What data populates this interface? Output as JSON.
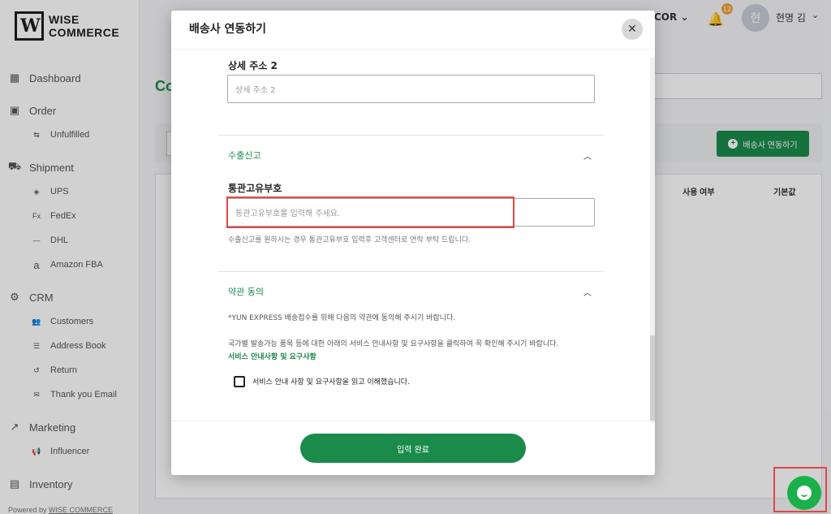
{
  "app": {
    "logo_letter": "W",
    "logo_line1": "WISE",
    "logo_line2": "COMMERCE",
    "powered_prefix": "Powered by",
    "powered_brand": "WISE COMMERCE"
  },
  "sidebar": {
    "dashboard": "Dashboard",
    "order": "Order",
    "unfulfilled": "Unfulfilled",
    "shipment": "Shipment",
    "ups": "UPS",
    "fedex": "FedEx",
    "dhl": "DHL",
    "amazon_fba": "Amazon FBA",
    "crm": "CRM",
    "customers": "Customers",
    "address_book": "Address Book",
    "return": "Return",
    "thank_you_email": "Thank you Email",
    "marketing": "Marketing",
    "influencer": "Influencer",
    "inventory": "Inventory"
  },
  "header": {
    "store_partial": "COR",
    "notification_count": "12",
    "avatar_initial": "현",
    "user_name": "현명 김"
  },
  "background": {
    "title_partial": "Co",
    "connect_button": "배송사 연동하기",
    "col_use": "사용 여부",
    "col_default": "기본값"
  },
  "modal": {
    "title": "배송사 연동하기",
    "close": "✕",
    "address2_label": "상세 주소 2",
    "address2_placeholder": "상세 주소 2",
    "export_section": "수출신고",
    "customs_label": "통관고유부호",
    "customs_placeholder": "통관고유부호를 입력해 주세요.",
    "customs_help": "수출신고를 원하시는 경우 통관고유부호 입력후 고객센터로 연락 부탁 드립니다.",
    "terms_section": "약관 동의",
    "terms_notice1": "*YUN EXPRESS 배송접수를 위해 다음의 약관에 동의해 주시기 바랍니다.",
    "terms_notice2": "국가별 발송가능 품목 등에 대한 아래의 서비스 안내사항 및 요구사항을 클릭하여 꼭 확인해 주시기 바랍니다.",
    "terms_link": "서비스 안내사항 및 요구사항",
    "terms_check": "서비스 안내 사항 및 요구사항을 읽고 이해했습니다.",
    "submit": "입력 완료"
  },
  "colors": {
    "accent": "#1a8b4a",
    "highlight": "#e04848",
    "chat": "#1ab14a"
  }
}
